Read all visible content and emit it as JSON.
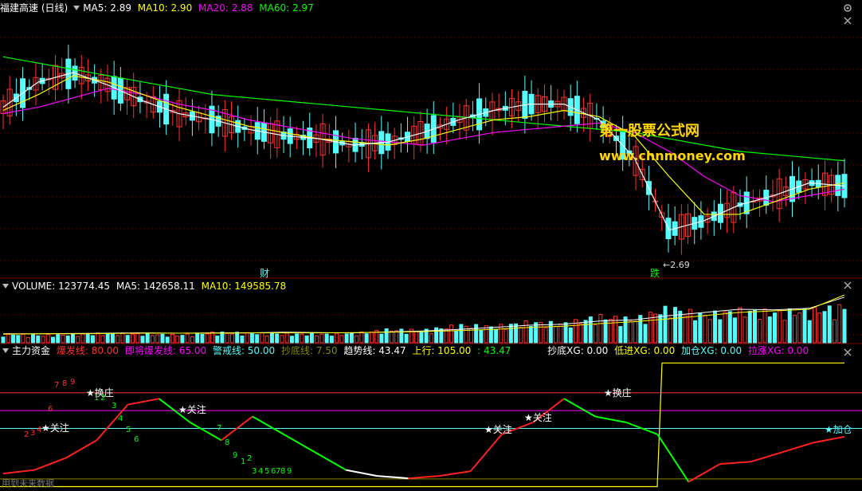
{
  "price_panel": {
    "stock_title": "福建高速 (日线)",
    "ma5_label": "MA5: 2.89",
    "ma10_label": "MA10: 2.90",
    "ma20_label": "MA20: 2.88",
    "ma60_label": "MA60: 2.97",
    "low_marker": "2.69",
    "event_cai": "财",
    "event_die": "跌",
    "colors": {
      "ma5": "#ffffff",
      "ma10": "#ffff00",
      "ma20": "#ff00ff",
      "ma60": "#00ff00",
      "up": "#ff3030",
      "down": "#54fcfc"
    }
  },
  "watermark": {
    "line1": "第一股票公式网",
    "line2": "www.chnmoney.com"
  },
  "volume_panel": {
    "volume_label": "VOLUME: 123774.45",
    "ma5_label": "MA5: 142658.11",
    "ma10_label": "MA10: 149585.78"
  },
  "indicator_panel": {
    "name": "主力资金",
    "bao_fa": "爆发线: 80.00",
    "ji_jiang": "即将爆发线: 65.00",
    "jing_jie": "警戒线: 50.00",
    "chao_di": "抄底线: 7.50",
    "qu_shi": "趋势线: 43.47",
    "shang_xing": "上行: 105.00",
    "extra": ": 43.47",
    "chaodi_xg": "抄底XG: 0.00",
    "dijin_xg": "低进XG: 0.00",
    "jiacang_xg": "加仓XG: 0.00",
    "lazhang_xg": "拉涨XG: 0.00",
    "bottom_note": "用到未来数据",
    "signals": [
      {
        "text": "★关注"
      },
      {
        "text": "★换庄"
      },
      {
        "text": "★关注"
      },
      {
        "text": "★关注"
      },
      {
        "text": "★关注"
      },
      {
        "text": "★换庄"
      },
      {
        "text": "★加仓"
      }
    ],
    "digits": [
      "2",
      "3",
      "4",
      "6",
      "7",
      "8",
      "9",
      "1",
      "2",
      "3",
      "4",
      "5",
      "6",
      "7",
      "8",
      "9",
      "1",
      "2",
      "3",
      "4",
      "5",
      "6",
      "7",
      "8",
      "9"
    ]
  },
  "chart_data": {
    "type": "line",
    "price": {
      "ma60": [
        3.3,
        3.28,
        3.26,
        3.24,
        3.22,
        3.2,
        3.18,
        3.17,
        3.16,
        3.15,
        3.14,
        3.13,
        3.12,
        3.11,
        3.1,
        3.09,
        3.08,
        3.07,
        3.06,
        3.04,
        3.02,
        3.0,
        2.99,
        2.98,
        2.97
      ],
      "ma20": [
        3.12,
        3.14,
        3.17,
        3.2,
        3.18,
        3.15,
        3.13,
        3.1,
        3.08,
        3.06,
        3.04,
        3.03,
        3.02,
        3.04,
        3.06,
        3.07,
        3.08,
        3.09,
        3.06,
        3.0,
        2.92,
        2.86,
        2.84,
        2.86,
        2.88
      ],
      "ma10": [
        3.13,
        3.18,
        3.24,
        3.22,
        3.18,
        3.14,
        3.11,
        3.08,
        3.06,
        3.04,
        3.03,
        3.02,
        3.04,
        3.07,
        3.1,
        3.11,
        3.13,
        3.11,
        3.05,
        2.92,
        2.8,
        2.8,
        2.84,
        2.88,
        2.9
      ],
      "ma5": [
        3.14,
        3.22,
        3.25,
        3.21,
        3.16,
        3.12,
        3.1,
        3.07,
        3.05,
        3.04,
        3.02,
        3.03,
        3.06,
        3.1,
        3.13,
        3.15,
        3.15,
        3.1,
        2.98,
        2.75,
        2.78,
        2.83,
        2.86,
        2.9,
        2.89
      ],
      "low_value": 2.69
    },
    "volume": {
      "values": [
        30,
        25,
        28,
        32,
        30,
        26,
        35,
        33,
        30,
        29,
        31,
        45,
        42,
        60,
        55,
        70,
        65,
        90,
        80,
        120,
        95,
        110,
        105,
        110,
        124
      ],
      "ma5": [
        28,
        28,
        29,
        30,
        31,
        30,
        31,
        31,
        33,
        32,
        31,
        34,
        37,
        42,
        48,
        55,
        58,
        68,
        72,
        85,
        95,
        105,
        103,
        108,
        143
      ],
      "ma10": [
        27,
        28,
        28,
        29,
        30,
        30,
        30,
        31,
        31,
        31,
        32,
        33,
        35,
        38,
        42,
        48,
        52,
        60,
        66,
        75,
        85,
        95,
        100,
        105,
        150
      ]
    },
    "indicator": {
      "trend": [
        12,
        15,
        25,
        40,
        70,
        75,
        55,
        40,
        60,
        45,
        30,
        15,
        10,
        8,
        10,
        14,
        45,
        55,
        75,
        60,
        55,
        45,
        5,
        20,
        22,
        30,
        38,
        43
      ],
      "shang_xing_level": 105,
      "bao_fa_level": 80,
      "ji_jiang_level": 65,
      "jing_jie_level": 50,
      "chao_di_level": 7.5
    }
  }
}
